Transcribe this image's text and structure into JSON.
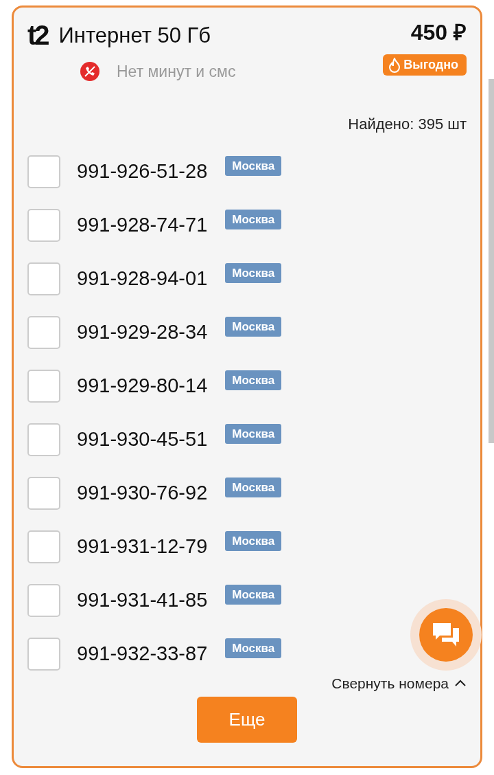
{
  "logo": "t2",
  "title": "Интернет 50 Гб",
  "price": "450 ₽",
  "badge": "Выгодно",
  "no_calls": "Нет минут и смс",
  "found": "Найдено: 395 шт",
  "numbers": [
    {
      "number": "991-926-51-28",
      "region": "Москва",
      "checked": false
    },
    {
      "number": "991-928-74-71",
      "region": "Москва",
      "checked": false
    },
    {
      "number": "991-928-94-01",
      "region": "Москва",
      "checked": false
    },
    {
      "number": "991-929-28-34",
      "region": "Москва",
      "checked": false
    },
    {
      "number": "991-929-80-14",
      "region": "Москва",
      "checked": false
    },
    {
      "number": "991-930-45-51",
      "region": "Москва",
      "checked": false
    },
    {
      "number": "991-930-76-92",
      "region": "Москва",
      "checked": false
    },
    {
      "number": "991-931-12-79",
      "region": "Москва",
      "checked": false
    },
    {
      "number": "991-931-41-85",
      "region": "Москва",
      "checked": false
    },
    {
      "number": "991-932-33-87",
      "region": "Москва",
      "checked": false
    }
  ],
  "collapse": "Свернуть номера",
  "more": "Еще"
}
